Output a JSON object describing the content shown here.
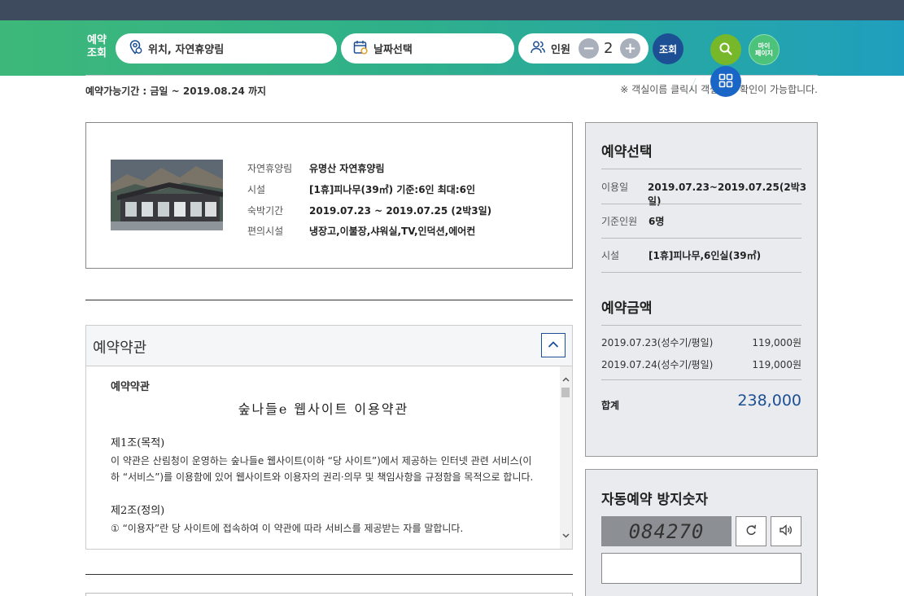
{
  "search": {
    "label_line1": "예약",
    "label_line2": "조회",
    "location": "위치, 자연휴양림",
    "date": "날짜선택",
    "person_label": "인원",
    "person_count": "2",
    "search_button": "조회",
    "mypage_line1": "마이",
    "mypage_line2": "페이지"
  },
  "period_text": "예약가능기간 : 금일 ~ 2019.08.24 까지",
  "notice_text": "※ 객실이름 클릭시 객실정보 확인이 가능합니다.",
  "info": {
    "rows": [
      {
        "key": "자연휴양림",
        "value": "유명산 자연휴양림"
      },
      {
        "key": "시설",
        "value": "[1휴]피나무(39㎡) 기준:6인 최대:6인"
      },
      {
        "key": "숙박기간",
        "value": "2019.07.23 ~ 2019.07.25 (2박3일)"
      },
      {
        "key": "편의시설",
        "value": "냉장고,이불장,샤워실,TV,인덕션,에어컨"
      }
    ]
  },
  "terms": {
    "title": "예약약관",
    "body_heading": "예약약관",
    "doc_title": "숲나들e 웹사이트 이용약관",
    "sec1_title": "제1조(목적)",
    "sec1_text": "이 약관은 산림청이 운영하는 숲나들e 웹사이트(이하 “당 사이트”)에서 제공하는 인터넷 관련 서비스(이하 “서비스”)를 이용함에 있어 웹사이트와 이용자의 권리·의무 및 책임사항을 규정함을 목적으로 합니다.",
    "sec2_title": "제2조(정의)",
    "sec2_text": "① “이용자”란 당 사이트에 접속하여 이 약관에 따라 서비스를 제공받는 자를 말합니다."
  },
  "selection": {
    "title": "예약선택",
    "rows": [
      {
        "key": "이용일",
        "value": "2019.07.23~2019.07.25(2박3일)"
      },
      {
        "key": "기준인원",
        "value": "6명"
      },
      {
        "key": "시설",
        "value": "[1휴]피나무,6인실(39㎡)"
      }
    ],
    "price_title": "예약금액",
    "prices": [
      {
        "date": "2019.07.23(성수기/평일)",
        "amount": "119,000원"
      },
      {
        "date": "2019.07.24(성수기/평일)",
        "amount": "119,000원"
      }
    ],
    "total_label": "합계",
    "total_value": "238,000"
  },
  "captcha": {
    "title": "자동예약 방지숫자",
    "code": "084270"
  }
}
